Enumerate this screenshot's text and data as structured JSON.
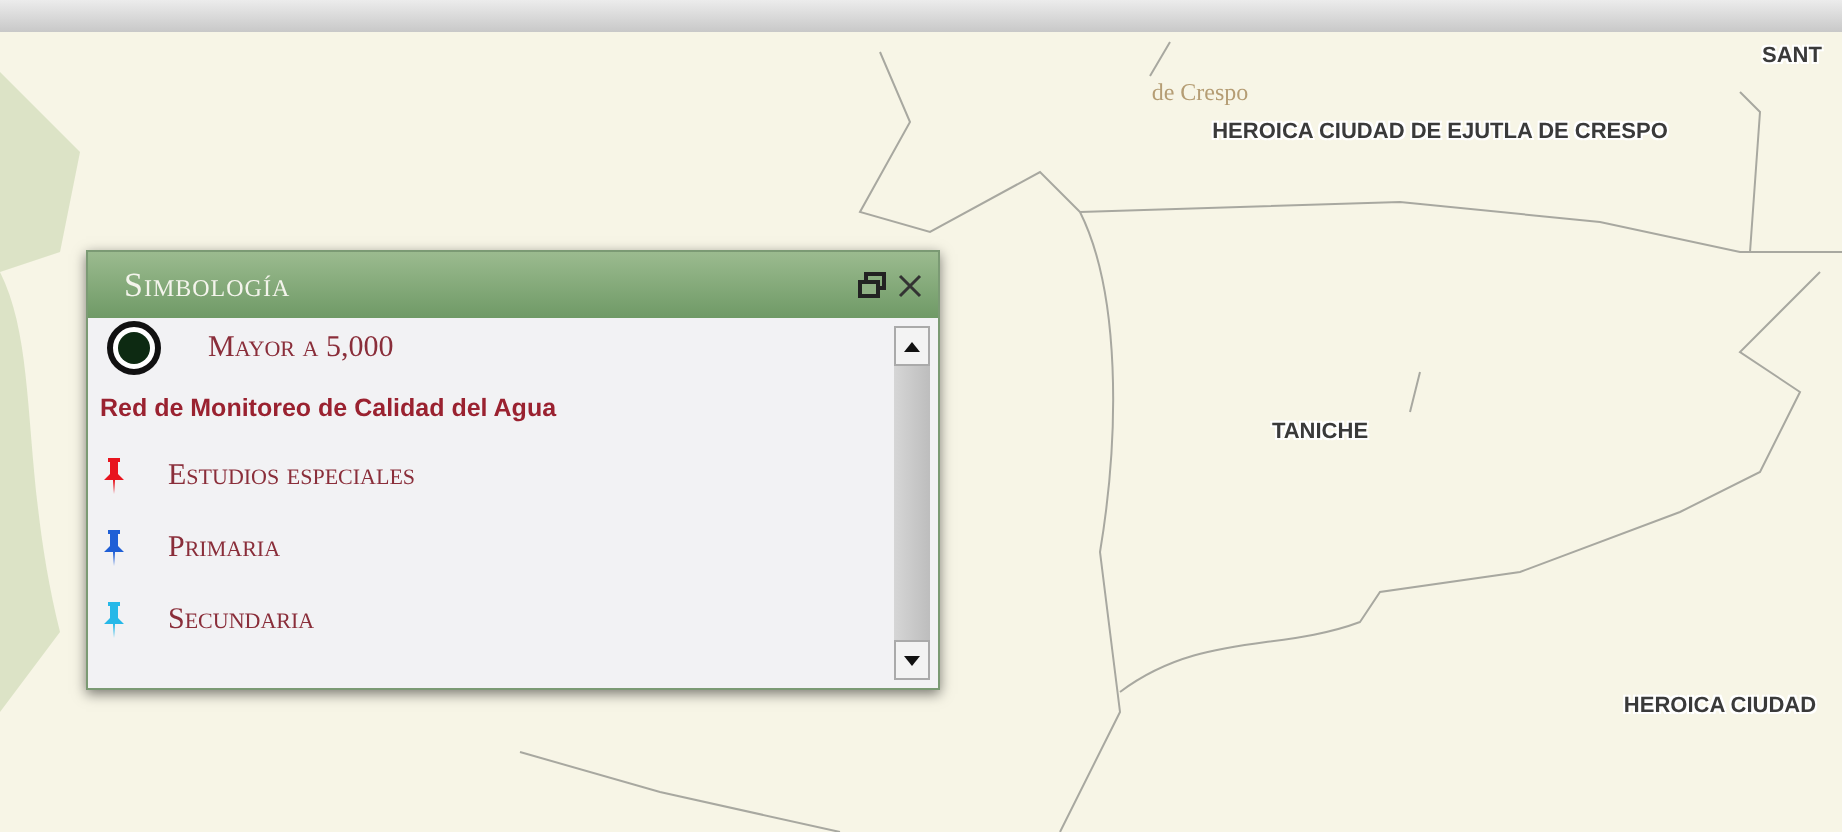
{
  "map": {
    "labels": [
      {
        "text": "de Crespo",
        "kind": "town"
      },
      {
        "text": "SANT",
        "kind": "place"
      },
      {
        "text": "HEROICA CIUDAD DE EJUTLA DE CRESPO",
        "kind": "place"
      },
      {
        "text": "TANICHE",
        "kind": "place"
      },
      {
        "text": "HEROICA CIUDAD",
        "kind": "place"
      }
    ]
  },
  "legend": {
    "title": "Simbología",
    "items": [
      {
        "kind": "circle",
        "label": "Mayor a 5,000"
      },
      {
        "kind": "heading",
        "label": "Red de Monitoreo de Calidad del Agua"
      },
      {
        "kind": "pin",
        "label": "Estudios especiales",
        "color": "#e8141e"
      },
      {
        "kind": "pin",
        "label": "Primaria",
        "color": "#1f5fd6"
      },
      {
        "kind": "pin",
        "label": "Secundaria",
        "color": "#26b8e8"
      }
    ]
  }
}
